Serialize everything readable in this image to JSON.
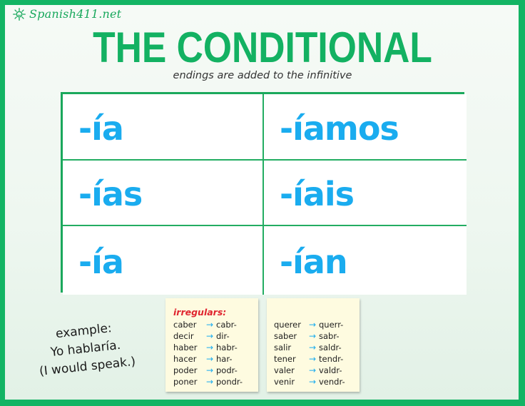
{
  "brand": {
    "icon": "sun-icon",
    "name": "Spanish411.net",
    "color": "#18a85c"
  },
  "title": "THE CONDITIONAL",
  "subtitle": "endings are added to the infinitive",
  "colors": {
    "border_green": "#13b464",
    "title_green": "#13b162",
    "ending_blue": "#1aacef",
    "heading_red": "#e0252f",
    "note_yellow": "#fefbe0"
  },
  "endings": {
    "rows": [
      {
        "singular": "-ía",
        "plural": "-íamos"
      },
      {
        "singular": "-ías",
        "plural": "-íais"
      },
      {
        "singular": "-ía",
        "plural": "-ían"
      }
    ]
  },
  "example": {
    "label": "example:",
    "sentence": "Yo hablaría.",
    "translation": "(I would speak.)"
  },
  "irregulars": {
    "heading": "irregulars:",
    "arrow": "→",
    "columns": [
      [
        {
          "verb": "caber",
          "stem": "cabr-"
        },
        {
          "verb": "decir",
          "stem": "dir-"
        },
        {
          "verb": "haber",
          "stem": "habr-"
        },
        {
          "verb": "hacer",
          "stem": "har-"
        },
        {
          "verb": "poder",
          "stem": "podr-"
        },
        {
          "verb": "poner",
          "stem": "pondr-"
        }
      ],
      [
        {
          "verb": "querer",
          "stem": "querr-"
        },
        {
          "verb": "saber",
          "stem": "sabr-"
        },
        {
          "verb": "salir",
          "stem": "saldr-"
        },
        {
          "verb": "tener",
          "stem": "tendr-"
        },
        {
          "verb": "valer",
          "stem": "valdr-"
        },
        {
          "verb": "venir",
          "stem": "vendr-"
        }
      ]
    ]
  }
}
